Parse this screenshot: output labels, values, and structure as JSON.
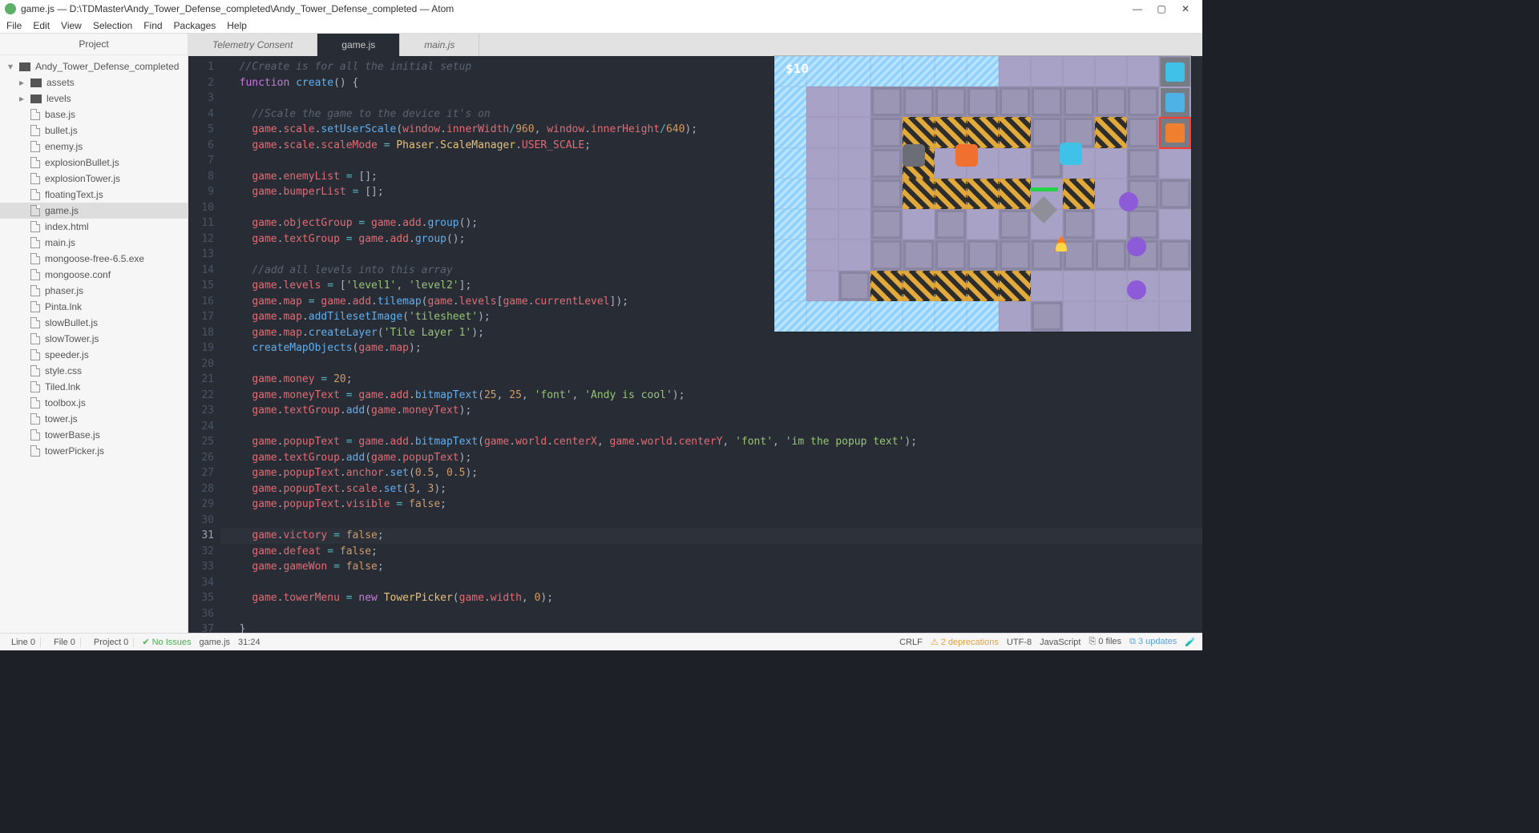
{
  "window": {
    "title": "game.js — D:\\TDMaster\\Andy_Tower_Defense_completed\\Andy_Tower_Defense_completed — Atom"
  },
  "menubar": [
    "File",
    "Edit",
    "View",
    "Selection",
    "Find",
    "Packages",
    "Help"
  ],
  "sidebar": {
    "header": "Project",
    "root": "Andy_Tower_Defense_completed",
    "folders": [
      "assets",
      "levels"
    ],
    "files": [
      "base.js",
      "bullet.js",
      "enemy.js",
      "explosionBullet.js",
      "explosionTower.js",
      "floatingText.js",
      "game.js",
      "index.html",
      "main.js",
      "mongoose-free-6.5.exe",
      "mongoose.conf",
      "phaser.js",
      "Pinta.lnk",
      "slowBullet.js",
      "slowTower.js",
      "speeder.js",
      "style.css",
      "Tiled.lnk",
      "toolbox.js",
      "tower.js",
      "towerBase.js",
      "towerPicker.js"
    ],
    "selected": "game.js"
  },
  "tabs": [
    {
      "label": "Telemetry Consent",
      "active": false
    },
    {
      "label": "game.js",
      "active": true
    },
    {
      "label": "main.js",
      "active": false
    }
  ],
  "code": {
    "first_line": 1,
    "last_line": 37,
    "highlighted_line": 31,
    "lines": [
      {
        "n": 1,
        "html": "  <span class='tok-comment'>//Create is for all the initial setup</span>"
      },
      {
        "n": 2,
        "html": "  <span class='tok-keyword'>function</span> <span class='tok-funcdef'>create</span><span class='tok-plain'>() {</span>"
      },
      {
        "n": 3,
        "html": ""
      },
      {
        "n": 4,
        "html": "    <span class='tok-comment'>//Scale the game to the device it's on</span>"
      },
      {
        "n": 5,
        "html": "    <span class='tok-var'>game</span><span class='tok-plain'>.</span><span class='tok-prop'>scale</span><span class='tok-plain'>.</span><span class='tok-func'>setUserScale</span><span class='tok-plain'>(</span><span class='tok-var'>window</span><span class='tok-plain'>.</span><span class='tok-prop'>innerWidth</span><span class='tok-op'>/</span><span class='tok-number'>960</span><span class='tok-plain'>, </span><span class='tok-var'>window</span><span class='tok-plain'>.</span><span class='tok-prop'>innerHeight</span><span class='tok-op'>/</span><span class='tok-number'>640</span><span class='tok-plain'>);</span>"
      },
      {
        "n": 6,
        "html": "    <span class='tok-var'>game</span><span class='tok-plain'>.</span><span class='tok-prop'>scale</span><span class='tok-plain'>.</span><span class='tok-prop'>scaleMode</span> <span class='tok-op'>=</span> <span class='tok-class'>Phaser</span><span class='tok-plain'>.</span><span class='tok-class'>ScaleManager</span><span class='tok-plain'>.</span><span class='tok-prop'>USER_SCALE</span><span class='tok-plain'>;</span>"
      },
      {
        "n": 7,
        "html": ""
      },
      {
        "n": 8,
        "html": "    <span class='tok-var'>game</span><span class='tok-plain'>.</span><span class='tok-prop'>enemyList</span> <span class='tok-op'>=</span> <span class='tok-plain'>[];</span>"
      },
      {
        "n": 9,
        "html": "    <span class='tok-var'>game</span><span class='tok-plain'>.</span><span class='tok-prop'>bumperList</span> <span class='tok-op'>=</span> <span class='tok-plain'>[];</span>"
      },
      {
        "n": 10,
        "html": ""
      },
      {
        "n": 11,
        "html": "    <span class='tok-var'>game</span><span class='tok-plain'>.</span><span class='tok-prop'>objectGroup</span> <span class='tok-op'>=</span> <span class='tok-var'>game</span><span class='tok-plain'>.</span><span class='tok-prop'>add</span><span class='tok-plain'>.</span><span class='tok-func'>group</span><span class='tok-plain'>();</span>"
      },
      {
        "n": 12,
        "html": "    <span class='tok-var'>game</span><span class='tok-plain'>.</span><span class='tok-prop'>textGroup</span> <span class='tok-op'>=</span> <span class='tok-var'>game</span><span class='tok-plain'>.</span><span class='tok-prop'>add</span><span class='tok-plain'>.</span><span class='tok-func'>group</span><span class='tok-plain'>();</span>"
      },
      {
        "n": 13,
        "html": ""
      },
      {
        "n": 14,
        "html": "    <span class='tok-comment'>//add all levels into this array</span>"
      },
      {
        "n": 15,
        "html": "    <span class='tok-var'>game</span><span class='tok-plain'>.</span><span class='tok-prop'>levels</span> <span class='tok-op'>=</span> <span class='tok-plain'>[</span><span class='tok-string'>'level1'</span><span class='tok-plain'>, </span><span class='tok-string'>'level2'</span><span class='tok-plain'>];</span>"
      },
      {
        "n": 16,
        "html": "    <span class='tok-var'>game</span><span class='tok-plain'>.</span><span class='tok-prop'>map</span> <span class='tok-op'>=</span> <span class='tok-var'>game</span><span class='tok-plain'>.</span><span class='tok-prop'>add</span><span class='tok-plain'>.</span><span class='tok-func'>tilemap</span><span class='tok-plain'>(</span><span class='tok-var'>game</span><span class='tok-plain'>.</span><span class='tok-prop'>levels</span><span class='tok-plain'>[</span><span class='tok-var'>game</span><span class='tok-plain'>.</span><span class='tok-prop'>currentLevel</span><span class='tok-plain'>]);</span>"
      },
      {
        "n": 17,
        "html": "    <span class='tok-var'>game</span><span class='tok-plain'>.</span><span class='tok-prop'>map</span><span class='tok-plain'>.</span><span class='tok-func'>addTilesetImage</span><span class='tok-plain'>(</span><span class='tok-string'>'tilesheet'</span><span class='tok-plain'>);</span>"
      },
      {
        "n": 18,
        "html": "    <span class='tok-var'>game</span><span class='tok-plain'>.</span><span class='tok-prop'>map</span><span class='tok-plain'>.</span><span class='tok-func'>createLayer</span><span class='tok-plain'>(</span><span class='tok-string'>'Tile Layer 1'</span><span class='tok-plain'>);</span>"
      },
      {
        "n": 19,
        "html": "    <span class='tok-func'>createMapObjects</span><span class='tok-plain'>(</span><span class='tok-var'>game</span><span class='tok-plain'>.</span><span class='tok-prop'>map</span><span class='tok-plain'>);</span>"
      },
      {
        "n": 20,
        "html": ""
      },
      {
        "n": 21,
        "html": "    <span class='tok-var'>game</span><span class='tok-plain'>.</span><span class='tok-prop'>money</span> <span class='tok-op'>=</span> <span class='tok-number'>20</span><span class='tok-plain'>;</span>"
      },
      {
        "n": 22,
        "html": "    <span class='tok-var'>game</span><span class='tok-plain'>.</span><span class='tok-prop'>moneyText</span> <span class='tok-op'>=</span> <span class='tok-var'>game</span><span class='tok-plain'>.</span><span class='tok-prop'>add</span><span class='tok-plain'>.</span><span class='tok-func'>bitmapText</span><span class='tok-plain'>(</span><span class='tok-number'>25</span><span class='tok-plain'>, </span><span class='tok-number'>25</span><span class='tok-plain'>, </span><span class='tok-string'>'font'</span><span class='tok-plain'>, </span><span class='tok-string'>'Andy is cool'</span><span class='tok-plain'>);</span>"
      },
      {
        "n": 23,
        "html": "    <span class='tok-var'>game</span><span class='tok-plain'>.</span><span class='tok-prop'>textGroup</span><span class='tok-plain'>.</span><span class='tok-func'>add</span><span class='tok-plain'>(</span><span class='tok-var'>game</span><span class='tok-plain'>.</span><span class='tok-prop'>moneyText</span><span class='tok-plain'>);</span>"
      },
      {
        "n": 24,
        "html": ""
      },
      {
        "n": 25,
        "html": "    <span class='tok-var'>game</span><span class='tok-plain'>.</span><span class='tok-prop'>popupText</span> <span class='tok-op'>=</span> <span class='tok-var'>game</span><span class='tok-plain'>.</span><span class='tok-prop'>add</span><span class='tok-plain'>.</span><span class='tok-func'>bitmapText</span><span class='tok-plain'>(</span><span class='tok-var'>game</span><span class='tok-plain'>.</span><span class='tok-prop'>world</span><span class='tok-plain'>.</span><span class='tok-prop'>centerX</span><span class='tok-plain'>, </span><span class='tok-var'>game</span><span class='tok-plain'>.</span><span class='tok-prop'>world</span><span class='tok-plain'>.</span><span class='tok-prop'>centerY</span><span class='tok-plain'>, </span><span class='tok-string'>'font'</span><span class='tok-plain'>, </span><span class='tok-string'>'im the popup text'</span><span class='tok-plain'>);</span>"
      },
      {
        "n": 26,
        "html": "    <span class='tok-var'>game</span><span class='tok-plain'>.</span><span class='tok-prop'>textGroup</span><span class='tok-plain'>.</span><span class='tok-func'>add</span><span class='tok-plain'>(</span><span class='tok-var'>game</span><span class='tok-plain'>.</span><span class='tok-prop'>popupText</span><span class='tok-plain'>);</span>"
      },
      {
        "n": 27,
        "html": "    <span class='tok-var'>game</span><span class='tok-plain'>.</span><span class='tok-prop'>popupText</span><span class='tok-plain'>.</span><span class='tok-prop'>anchor</span><span class='tok-plain'>.</span><span class='tok-func'>set</span><span class='tok-plain'>(</span><span class='tok-number'>0.5</span><span class='tok-plain'>, </span><span class='tok-number'>0.5</span><span class='tok-plain'>);</span>"
      },
      {
        "n": 28,
        "html": "    <span class='tok-var'>game</span><span class='tok-plain'>.</span><span class='tok-prop'>popupText</span><span class='tok-plain'>.</span><span class='tok-prop'>scale</span><span class='tok-plain'>.</span><span class='tok-func'>set</span><span class='tok-plain'>(</span><span class='tok-number'>3</span><span class='tok-plain'>, </span><span class='tok-number'>3</span><span class='tok-plain'>);</span>"
      },
      {
        "n": 29,
        "html": "    <span class='tok-var'>game</span><span class='tok-plain'>.</span><span class='tok-prop'>popupText</span><span class='tok-plain'>.</span><span class='tok-prop'>visible</span> <span class='tok-op'>=</span> <span class='tok-number'>false</span><span class='tok-plain'>;</span>"
      },
      {
        "n": 30,
        "html": ""
      },
      {
        "n": 31,
        "html": "    <span class='tok-var'>game</span><span class='tok-plain'>.</span><span class='tok-prop'>victory</span> <span class='tok-op'>=</span> <span class='tok-number'>false</span><span class='tok-plain'>;</span>"
      },
      {
        "n": 32,
        "html": "    <span class='tok-var'>game</span><span class='tok-plain'>.</span><span class='tok-prop'>defeat</span> <span class='tok-op'>=</span> <span class='tok-number'>false</span><span class='tok-plain'>;</span>"
      },
      {
        "n": 33,
        "html": "    <span class='tok-var'>game</span><span class='tok-plain'>.</span><span class='tok-prop'>gameWon</span> <span class='tok-op'>=</span> <span class='tok-number'>false</span><span class='tok-plain'>;</span>"
      },
      {
        "n": 34,
        "html": ""
      },
      {
        "n": 35,
        "html": "    <span class='tok-var'>game</span><span class='tok-plain'>.</span><span class='tok-prop'>towerMenu</span> <span class='tok-op'>=</span> <span class='tok-keyword'>new</span> <span class='tok-class'>TowerPicker</span><span class='tok-plain'>(</span><span class='tok-var'>game</span><span class='tok-plain'>.</span><span class='tok-prop'>width</span><span class='tok-plain'>, </span><span class='tok-number'>0</span><span class='tok-plain'>);</span>"
      },
      {
        "n": 36,
        "html": ""
      },
      {
        "n": 37,
        "html": "  <span class='tok-plain'>}</span>"
      }
    ]
  },
  "game_preview": {
    "money": "$10"
  },
  "statusbar": {
    "line": "Line  0",
    "file": "File  0",
    "project": "Project  0",
    "issues": "No Issues",
    "filename": "game.js",
    "cursor": "31:24",
    "eol": "CRLF",
    "deprecations": "2 deprecations",
    "encoding": "UTF-8",
    "language": "JavaScript",
    "git_files": "0 files",
    "updates": "3 updates"
  }
}
